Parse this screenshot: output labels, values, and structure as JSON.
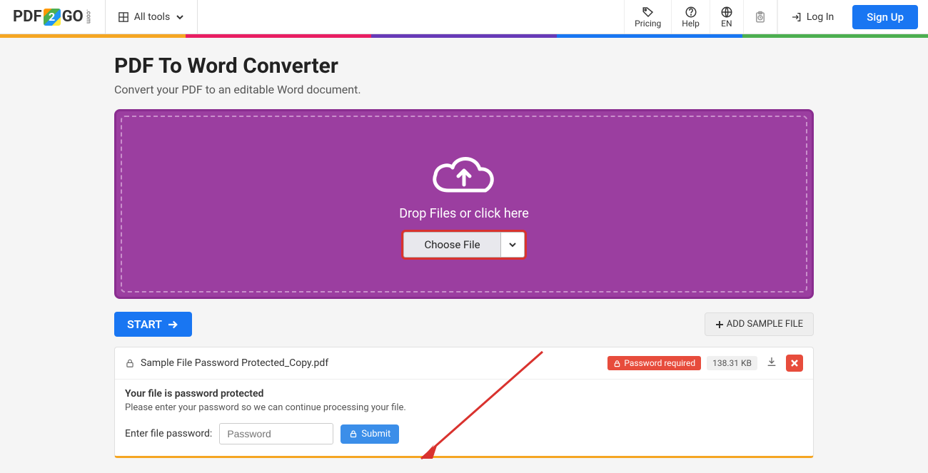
{
  "header": {
    "logo_left": "PDF",
    "logo_mid": "2",
    "logo_right": "GO",
    "logo_sub": ".com",
    "all_tools": "All tools",
    "pricing": "Pricing",
    "help": "Help",
    "lang": "EN",
    "login": "Log In",
    "signup": "Sign Up"
  },
  "rainbow_colors": [
    "#f5a623",
    "#e91e63",
    "#673ab7",
    "#1976f2",
    "#4caf50"
  ],
  "page": {
    "title": "PDF To Word Converter",
    "subtitle": "Convert your PDF to an editable Word document.",
    "drop_text": "Drop Files or click here",
    "choose_file": "Choose File",
    "start": "START",
    "add_sample": "ADD SAMPLE FILE"
  },
  "file": {
    "name": "Sample File Password Protected_Copy.pdf",
    "password_required": "Password required",
    "size": "138.31 KB",
    "pw_title": "Your file is password protected",
    "pw_desc": "Please enter your password so we can continue processing your file.",
    "pw_label": "Enter file password:",
    "pw_placeholder": "Password",
    "submit": "Submit"
  }
}
